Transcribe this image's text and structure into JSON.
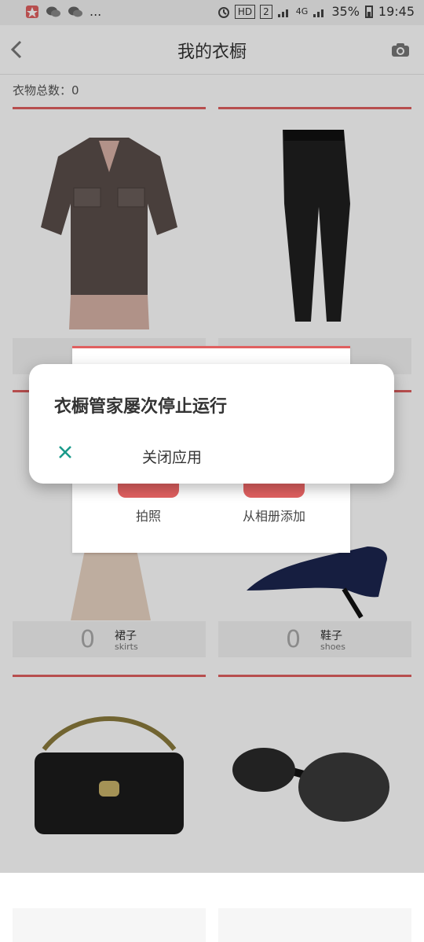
{
  "status_bar": {
    "left_ellipsis": "...",
    "hd": "HD",
    "sim": "2",
    "net": "4G",
    "battery": "35%",
    "time": "19:45"
  },
  "appbar": {
    "title": "我的衣橱"
  },
  "summary": {
    "count_label": "衣物总数：0"
  },
  "cards": [
    {
      "count": "0",
      "label": "裙子",
      "sub": "skirts"
    },
    {
      "count": "0",
      "label": "鞋子",
      "sub": "shoes"
    }
  ],
  "sheet": {
    "take_photo": "拍照",
    "add_from_album": "从相册添加"
  },
  "dialog": {
    "title": "衣橱管家屡次停止运行",
    "close_app": "关闭应用"
  },
  "colors": {
    "accent_red": "#e06060",
    "teal": "#1a9a8a"
  }
}
